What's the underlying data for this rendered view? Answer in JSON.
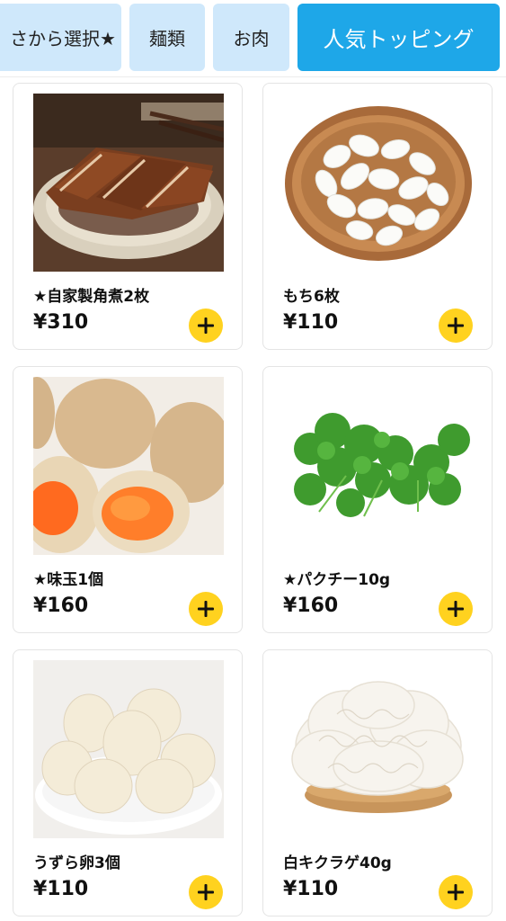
{
  "tabs": [
    {
      "label": "さから選択★",
      "active": false
    },
    {
      "label": "麺類",
      "active": false
    },
    {
      "label": "お肉",
      "active": false
    },
    {
      "label": "人気トッピング",
      "active": true
    }
  ],
  "colors": {
    "active_tab": "#1ea7e8",
    "inactive_tab": "#cfe8fb",
    "add_button": "#ffd21f"
  },
  "products": [
    {
      "name": "★自家製角煮2枚",
      "price": "¥310",
      "image": "braised-pork-belly"
    },
    {
      "name": "もち6枚",
      "price": "¥110",
      "image": "rice-cakes-in-basket"
    },
    {
      "name": "★味玉1個",
      "price": "¥160",
      "image": "marinated-eggs"
    },
    {
      "name": "★パクチー10g",
      "price": "¥160",
      "image": "cilantro"
    },
    {
      "name": "うずら卵3個",
      "price": "¥110",
      "image": "quail-eggs"
    },
    {
      "name": "白キクラゲ40g",
      "price": "¥110",
      "image": "white-fungus"
    }
  ],
  "icons": {
    "add": "plus-icon"
  }
}
